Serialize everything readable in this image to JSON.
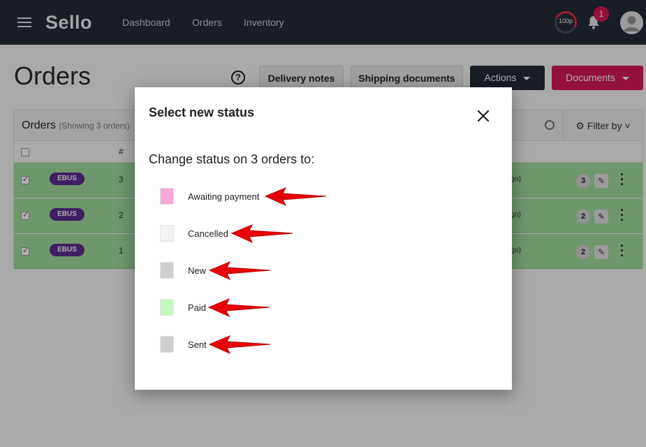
{
  "topbar": {
    "logo": "Sello",
    "nav": [
      "Dashboard",
      "Orders",
      "Inventory"
    ],
    "score": "100p",
    "notifications": "1"
  },
  "page": {
    "title": "Orders",
    "help": "?",
    "buttons": {
      "delivery_notes": "Delivery notes",
      "shipping_documents": "Shipping documents",
      "actions": "Actions",
      "documents": "Documents"
    }
  },
  "orders": {
    "title": "Orders",
    "subtitle": "(Showing 3 orders)",
    "filter": "Filter by",
    "col_hash": "#",
    "rows": [
      {
        "tag": "EBUS",
        "num": "3",
        "ago": "ago)",
        "count": "3"
      },
      {
        "tag": "EBUS",
        "num": "2",
        "ago": "ago)",
        "count": "2"
      },
      {
        "tag": "EBUS",
        "num": "1",
        "ago": "ago)",
        "count": "2"
      }
    ]
  },
  "modal": {
    "title": "Select new status",
    "subtitle": "Change status on 3 orders to:",
    "options": [
      {
        "label": "Awaiting payment",
        "color": "#f9a6d8"
      },
      {
        "label": "Cancelled",
        "color": "#f2f2f2"
      },
      {
        "label": "New",
        "color": "#cfcfcf"
      },
      {
        "label": "Paid",
        "color": "#c2f7c2"
      },
      {
        "label": "Sent",
        "color": "#cfcfcf"
      }
    ]
  },
  "colors": {
    "topbar": "#262b38",
    "accent": "#d81b5b",
    "row_green": "#a5dda2",
    "tag": "#5c2e8f",
    "arrow": "#e8000a"
  }
}
